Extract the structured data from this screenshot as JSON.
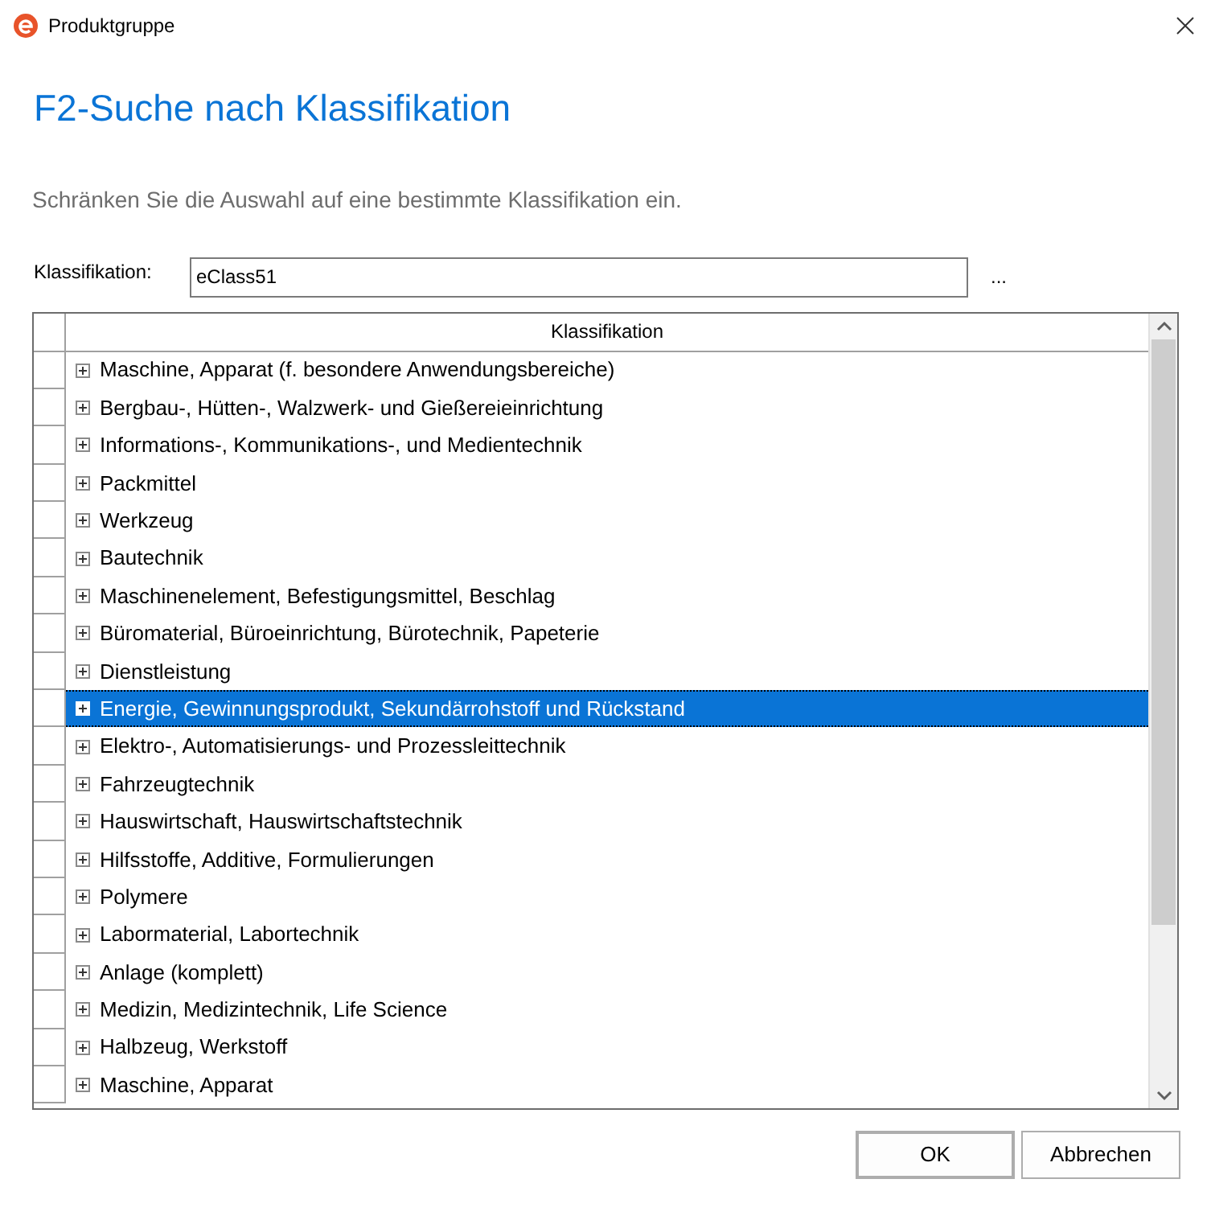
{
  "window": {
    "title": "Produktgruppe"
  },
  "heading": "F2-Suche nach Klassifikation",
  "description": "Schränken Sie die Auswahl auf eine bestimmte Klassifikation ein.",
  "field": {
    "label": "Klassifikation:",
    "value": "eClass51",
    "browse": "..."
  },
  "grid": {
    "columns": [
      "Klassifikation"
    ],
    "rows": [
      {
        "label": "Maschine, Apparat (f. besondere Anwendungsbereiche)",
        "selected": false
      },
      {
        "label": "Bergbau-, Hütten-, Walzwerk- und Gießereieinrichtung",
        "selected": false
      },
      {
        "label": "Informations-, Kommunikations-, und Medientechnik",
        "selected": false
      },
      {
        "label": "Packmittel",
        "selected": false
      },
      {
        "label": "Werkzeug",
        "selected": false
      },
      {
        "label": "Bautechnik",
        "selected": false
      },
      {
        "label": "Maschinenelement, Befestigungsmittel, Beschlag",
        "selected": false
      },
      {
        "label": "Büromaterial, Büroeinrichtung, Bürotechnik, Papeterie",
        "selected": false
      },
      {
        "label": "Dienstleistung",
        "selected": false
      },
      {
        "label": "Energie, Gewinnungsprodukt, Sekundärrohstoff und Rückstand",
        "selected": true
      },
      {
        "label": "Elektro-, Automatisierungs- und Prozessleittechnik",
        "selected": false
      },
      {
        "label": "Fahrzeugtechnik",
        "selected": false
      },
      {
        "label": "Hauswirtschaft, Hauswirtschaftstechnik",
        "selected": false
      },
      {
        "label": "Hilfsstoffe, Additive, Formulierungen",
        "selected": false
      },
      {
        "label": "Polymere",
        "selected": false
      },
      {
        "label": "Labormaterial, Labortechnik",
        "selected": false
      },
      {
        "label": "Anlage (komplett)",
        "selected": false
      },
      {
        "label": "Medizin, Medizintechnik, Life Science",
        "selected": false
      },
      {
        "label": "Halbzeug, Werkstoff",
        "selected": false
      },
      {
        "label": "Maschine, Apparat",
        "selected": false
      }
    ]
  },
  "buttons": [
    "OK",
    "Abbrechen"
  ]
}
